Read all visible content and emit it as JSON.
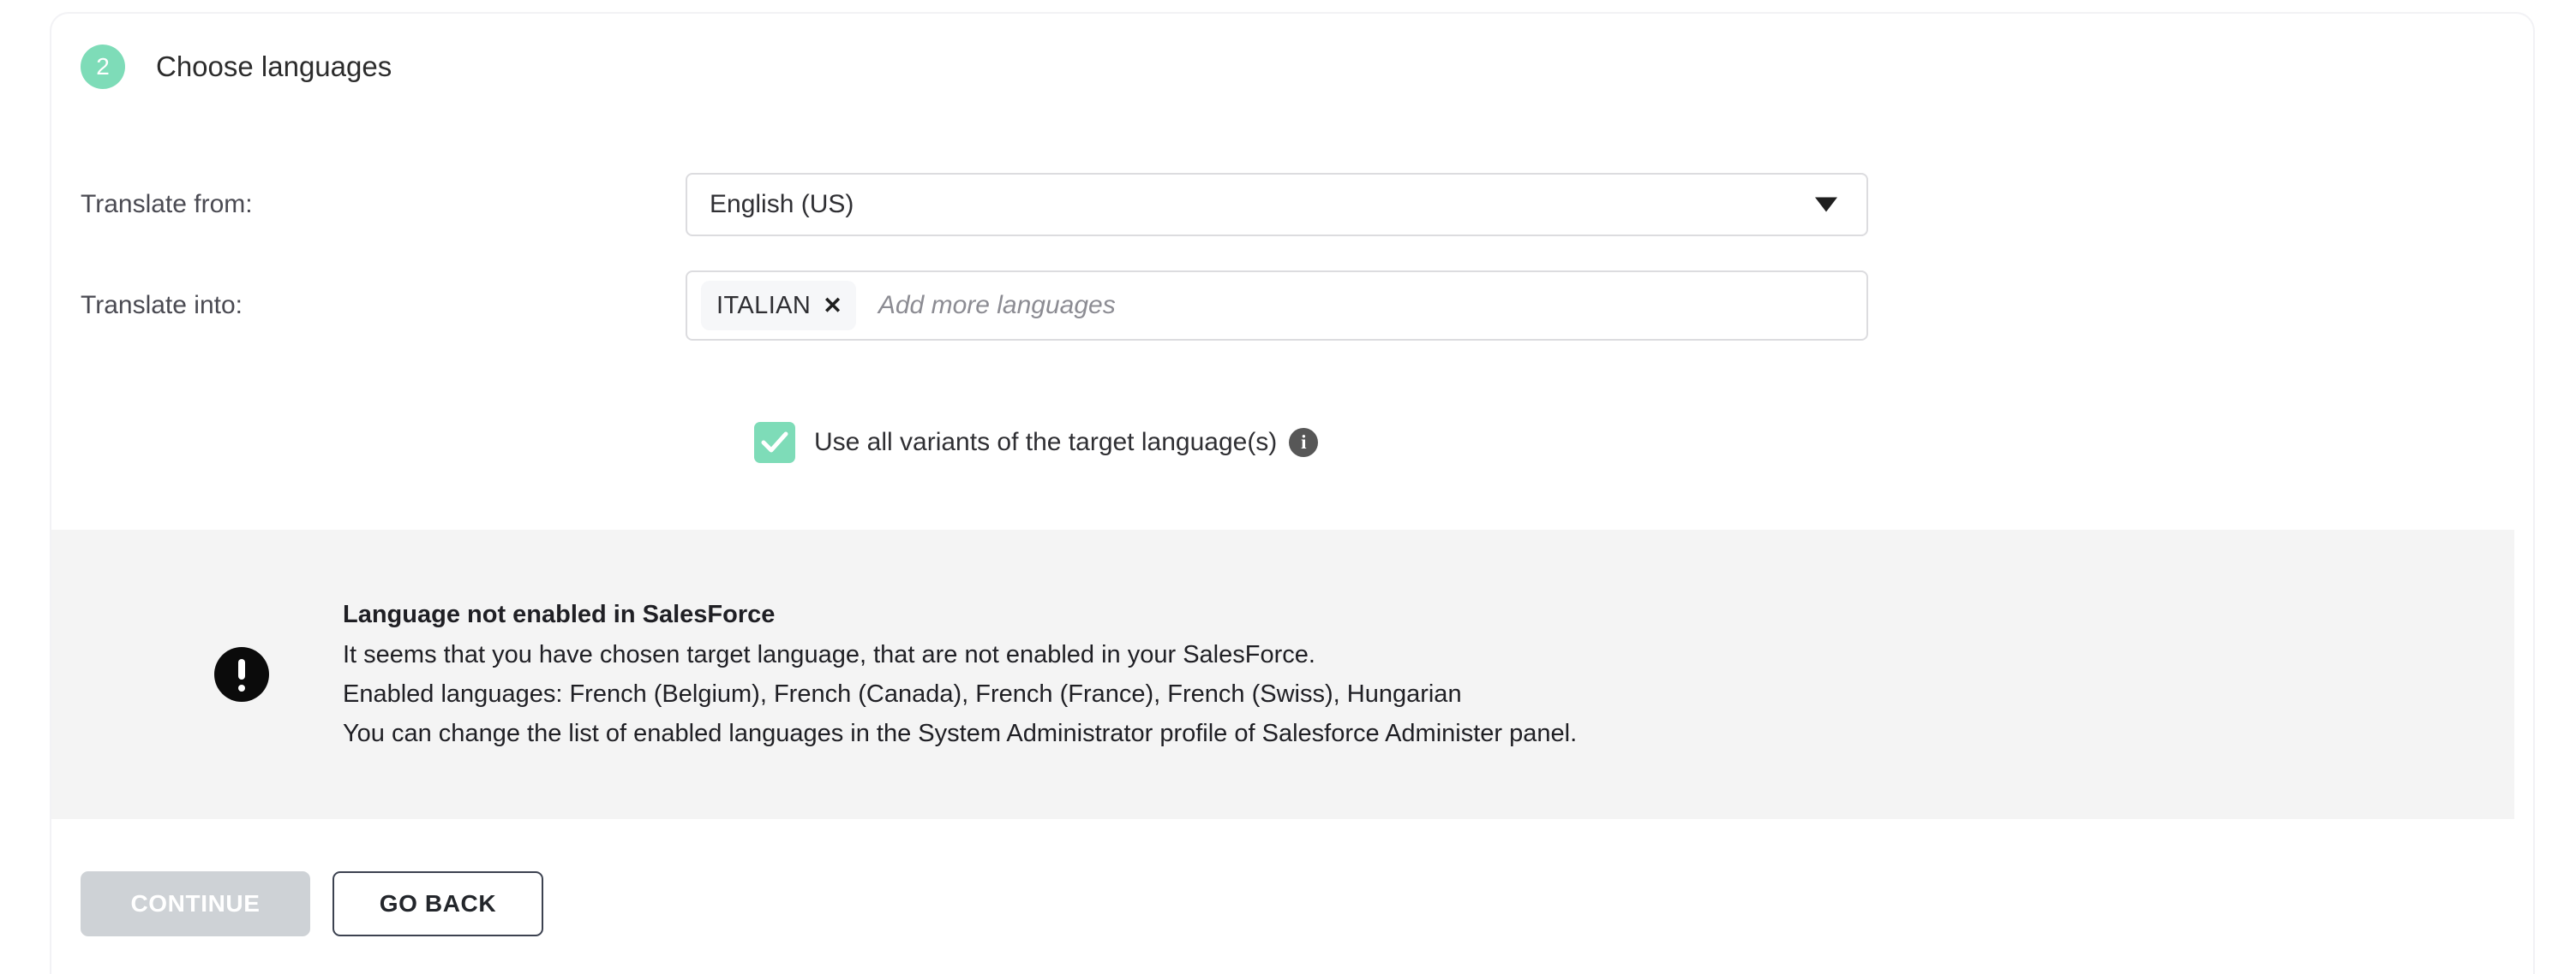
{
  "step": {
    "number": "2",
    "title": "Choose languages",
    "badge_color": "#7edcb8"
  },
  "form": {
    "source_label": "Translate from:",
    "source_value": "English (US)",
    "source_caret_icon": "chevron-down-icon",
    "target_label": "Translate into:",
    "target_tags": [
      {
        "label": "ITALIAN",
        "remove_icon": "close-icon",
        "remove_glyph": "✕"
      }
    ],
    "target_placeholder": "Add more languages"
  },
  "variants_option": {
    "checked": true,
    "label": "Use all variants of the target language(s)",
    "info_icon": "info-icon",
    "info_glyph": "i",
    "checkbox_color": "#7edcb8"
  },
  "warning": {
    "icon": "exclamation-circle-icon",
    "title": "Language not enabled in SalesForce",
    "lines": [
      "It seems that you have chosen target language, that are not enabled in your SalesForce.",
      "Enabled languages: French (Belgium), French (Canada), French (France), French (Swiss), Hungarian",
      "You can change the list of enabled languages in the System Administrator profile of Salesforce Administer panel."
    ],
    "background_color": "#f4f4f4"
  },
  "actions": {
    "continue_label": "CONTINUE",
    "continue_disabled": true,
    "go_back_label": "GO BACK"
  }
}
